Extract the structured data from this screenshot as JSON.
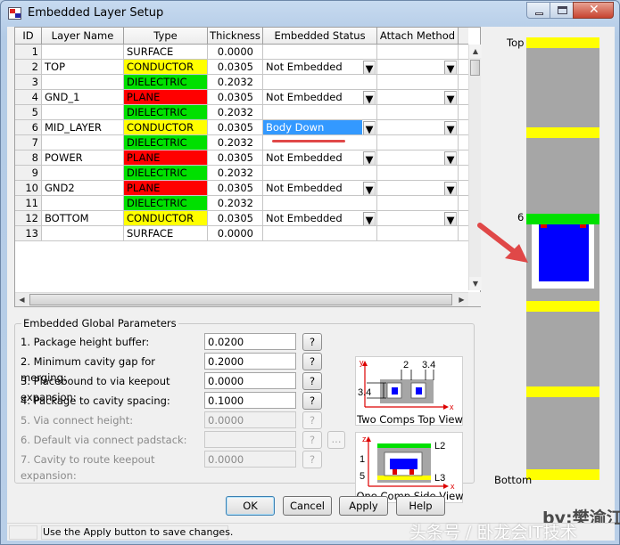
{
  "window": {
    "title": "Embedded Layer Setup"
  },
  "grid": {
    "headers": [
      "ID",
      "Layer Name",
      "Type",
      "Thickness",
      "Embedded Status",
      "Attach Method"
    ],
    "rows": [
      {
        "id": "1",
        "name": "",
        "type": "SURFACE",
        "thickness": "0.0000",
        "status": "",
        "attach": ""
      },
      {
        "id": "2",
        "name": "TOP",
        "type": "CONDUCTOR",
        "thickness": "0.0305",
        "status": "Not Embedded",
        "attach": ""
      },
      {
        "id": "3",
        "name": "",
        "type": "DIELECTRIC",
        "thickness": "0.2032",
        "status": "",
        "attach": ""
      },
      {
        "id": "4",
        "name": "GND_1",
        "type": "PLANE",
        "thickness": "0.0305",
        "status": "Not Embedded",
        "attach": ""
      },
      {
        "id": "5",
        "name": "",
        "type": "DIELECTRIC",
        "thickness": "0.2032",
        "status": "",
        "attach": ""
      },
      {
        "id": "6",
        "name": "MID_LAYER",
        "type": "CONDUCTOR",
        "thickness": "0.0305",
        "status": "Body Down",
        "attach": ""
      },
      {
        "id": "7",
        "name": "",
        "type": "DIELECTRIC",
        "thickness": "0.2032",
        "status": "",
        "attach": ""
      },
      {
        "id": "8",
        "name": "POWER",
        "type": "PLANE",
        "thickness": "0.0305",
        "status": "Not Embedded",
        "attach": ""
      },
      {
        "id": "9",
        "name": "",
        "type": "DIELECTRIC",
        "thickness": "0.2032",
        "status": "",
        "attach": ""
      },
      {
        "id": "10",
        "name": "GND2",
        "type": "PLANE",
        "thickness": "0.0305",
        "status": "Not Embedded",
        "attach": ""
      },
      {
        "id": "11",
        "name": "",
        "type": "DIELECTRIC",
        "thickness": "0.2032",
        "status": "",
        "attach": ""
      },
      {
        "id": "12",
        "name": "BOTTOM",
        "type": "CONDUCTOR",
        "thickness": "0.0305",
        "status": "Not Embedded",
        "attach": ""
      },
      {
        "id": "13",
        "name": "",
        "type": "SURFACE",
        "thickness": "0.0000",
        "status": "",
        "attach": ""
      }
    ],
    "type_colors": {
      "SURFACE": "#ffffff",
      "CONDUCTOR": "#ffff00",
      "DIELECTRIC": "#00e000",
      "PLANE": "#ff0000"
    }
  },
  "params": {
    "legend": "Embedded Global Parameters",
    "items": [
      {
        "label": "1. Package height buffer:",
        "value": "0.0200",
        "enabled": true
      },
      {
        "label": "2. Minimum cavity gap for merging:",
        "value": "0.2000",
        "enabled": true
      },
      {
        "label": "3. Placebound to via keepout expansion:",
        "value": "0.0000",
        "enabled": true
      },
      {
        "label": "4. Package to cavity spacing:",
        "value": "0.1000",
        "enabled": true
      },
      {
        "label": "5. Via connect height:",
        "value": "0.0000",
        "enabled": false
      },
      {
        "label": "6. Default via connect padstack:",
        "value": "",
        "enabled": false
      },
      {
        "label": "7. Cavity to route keepout expansion:",
        "value": "0.0000",
        "enabled": false
      }
    ],
    "help_label": "?",
    "browse_label": "..."
  },
  "diagrams": {
    "top_caption": "Two Comps Top View",
    "side_caption": "One Comp Side View",
    "top_labels": {
      "y": "y",
      "x": "x",
      "d1": "2",
      "d2": "3.4",
      "d3": "3.4"
    },
    "side_labels": {
      "z": "z",
      "x": "x",
      "l2": "L2",
      "l3": "L3",
      "d1": "1",
      "d2": "5"
    }
  },
  "buttons": {
    "ok": "OK",
    "cancel": "Cancel",
    "apply": "Apply",
    "help": "Help"
  },
  "status": {
    "text": "Use the Apply button to save changes."
  },
  "stack_preview": {
    "top_label": "Top",
    "bottom_label": "Bottom",
    "layer_label": "6"
  },
  "watermarks": {
    "author": "by:樊渝江",
    "source": "头条号 / 卧龙会IT技术"
  },
  "colors": {
    "accent_select": "#3399ff",
    "preview_bg": "#a6a6a6",
    "component": "#0000ff",
    "arrow": "#e04848"
  }
}
